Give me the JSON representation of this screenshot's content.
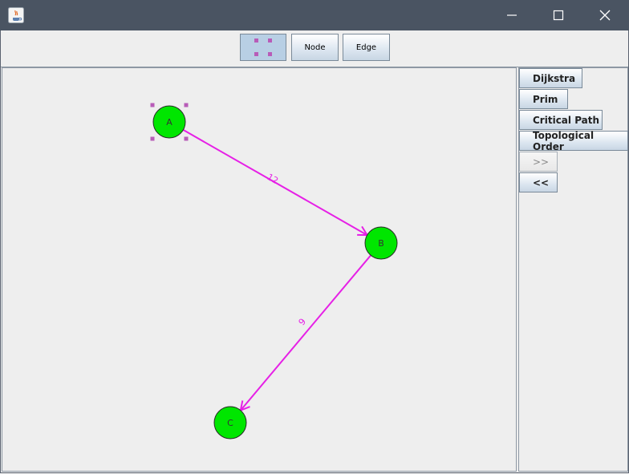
{
  "toolbar": {
    "node_label": "Node",
    "edge_label": "Edge"
  },
  "graph": {
    "nodes": [
      {
        "label": "A",
        "selected": true
      },
      {
        "label": "B",
        "selected": false
      },
      {
        "label": "C",
        "selected": false
      }
    ],
    "edges": [
      {
        "from": "A",
        "to": "B",
        "weight": "12"
      },
      {
        "from": "B",
        "to": "C",
        "weight": "6"
      }
    ],
    "node_color": "#00e600",
    "edge_color": "#e620e6",
    "selection_color": "#b85cb8"
  },
  "side_panel": {
    "dijkstra_label": "Dijkstra",
    "prim_label": "Prim",
    "critical_path_label": "Critical Path",
    "topological_order_label": "Topological Order",
    "next_label": ">>",
    "prev_label": "<<"
  }
}
